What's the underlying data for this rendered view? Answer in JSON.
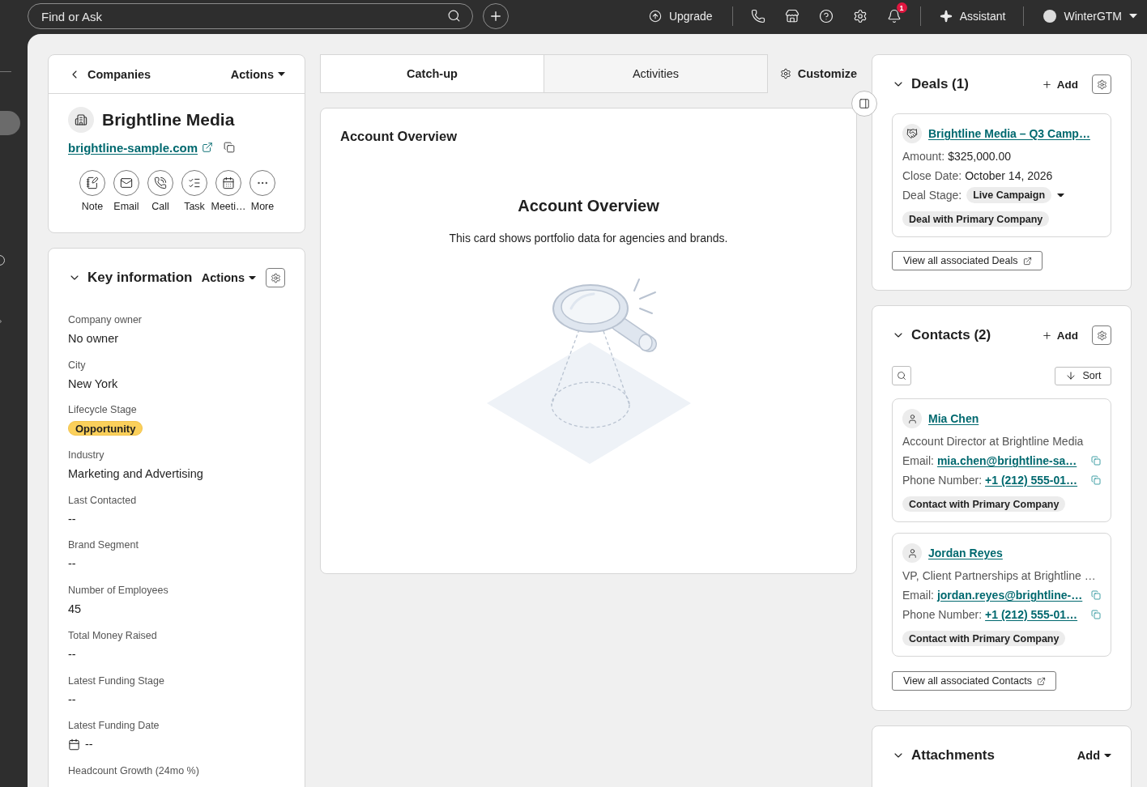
{
  "top_bar": {
    "search": {
      "placeholder": "Find or Ask"
    },
    "upgrade": "Upgrade",
    "notification_count": "1",
    "assistant": "Assistant",
    "account": "WinterGTM"
  },
  "company": {
    "back": "Companies",
    "actions": "Actions",
    "name": "Brightline Media",
    "website": "brightline-sample.com",
    "quick_actions": [
      {
        "kind": "note",
        "label": "Note"
      },
      {
        "kind": "email",
        "label": "Email"
      },
      {
        "kind": "call",
        "label": "Call"
      },
      {
        "kind": "task",
        "label": "Task"
      },
      {
        "kind": "meeting",
        "label": "Meeti…"
      },
      {
        "kind": "more",
        "label": "More"
      }
    ]
  },
  "key_information": {
    "title": "Key information",
    "actions": "Actions",
    "expanded": true,
    "fields": [
      {
        "label": "Company owner",
        "value": "No owner",
        "kind": "text"
      },
      {
        "label": "City",
        "value": "New York",
        "kind": "text"
      },
      {
        "label": "Lifecycle Stage",
        "value": "Opportunity",
        "kind": "badge"
      },
      {
        "label": "Industry",
        "value": "Marketing and Advertising",
        "kind": "text"
      },
      {
        "label": "Last Contacted",
        "value": "--",
        "kind": "text"
      },
      {
        "label": "Brand Segment",
        "value": "--",
        "kind": "text"
      },
      {
        "label": "Number of Employees",
        "value": "45",
        "kind": "text"
      },
      {
        "label": "Total Money Raised",
        "value": "--",
        "kind": "text"
      },
      {
        "label": "Latest Funding Stage",
        "value": "--",
        "kind": "text"
      },
      {
        "label": "Latest Funding Date",
        "value": "--",
        "kind": "date"
      },
      {
        "label": "Headcount Growth (24mo %)"
      }
    ]
  },
  "tabs": [
    {
      "label": "Catch-up",
      "selected": true
    },
    {
      "label": "Activities",
      "selected": false
    }
  ],
  "customize": "Customize",
  "overview": {
    "title": "Account Overview",
    "heading": "Account Overview",
    "description": "This card shows portfolio data for agencies and brands."
  },
  "deals": {
    "title": "Deals (1)",
    "expanded": true,
    "add": "Add",
    "items": [
      {
        "name": "Brightline Media – Q3 Camp…",
        "details": [
          {
            "label": "Amount:",
            "value": "$325,000.00"
          },
          {
            "label": "Close Date:",
            "value": "October 14, 2026"
          }
        ],
        "stage_label": "Deal Stage:",
        "stage": "Live Campaign",
        "tag": "Deal with Primary Company"
      }
    ],
    "view_all": "View all associated Deals"
  },
  "contacts": {
    "title": "Contacts (2)",
    "expanded": true,
    "add": "Add",
    "sort": "Sort",
    "items": [
      {
        "name": "Mia Chen",
        "title": "Account Director at Brightline Media",
        "email_label": "Email:",
        "email": "mia.chen@brightline-sa…",
        "phone_label": "Phone Number:",
        "phone": "+1 (212) 555-01…",
        "tag": "Contact with Primary Company"
      },
      {
        "name": "Jordan Reyes",
        "title": "VP, Client Partnerships at Brightline …",
        "email_label": "Email:",
        "email": "jordan.reyes@brightline-…",
        "phone_label": "Phone Number:",
        "phone": "+1 (212) 555-01…",
        "tag": "Contact with Primary Company"
      }
    ],
    "view_all": "View all associated Contacts"
  },
  "attachments": {
    "title": "Attachments",
    "expanded": true,
    "add": "Add"
  }
}
